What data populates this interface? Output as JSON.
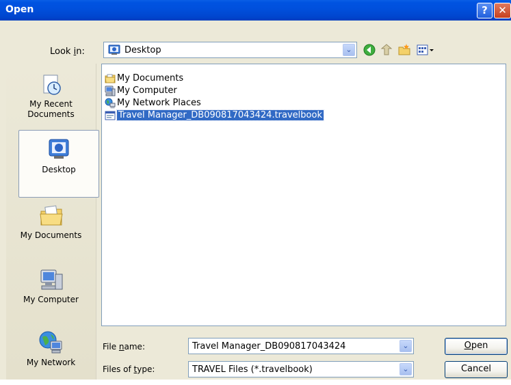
{
  "window": {
    "title": "Open",
    "help_glyph": "?",
    "close_glyph": "✕"
  },
  "lookin": {
    "label_pre": "Look ",
    "label_u": "i",
    "label_post": "n:",
    "value": "Desktop",
    "arrow": "⌄"
  },
  "places": [
    {
      "id": "recent",
      "label1": "My Recent",
      "label2": "Documents",
      "icon": "recent-documents-icon"
    },
    {
      "id": "desktop",
      "label1": "Desktop",
      "label2": "",
      "icon": "desktop-icon"
    },
    {
      "id": "mydocs",
      "label1": "My Documents",
      "label2": "",
      "icon": "my-documents-folder-icon"
    },
    {
      "id": "mycomp",
      "label1": "My Computer",
      "label2": "",
      "icon": "my-computer-icon"
    },
    {
      "id": "mynet",
      "label1": "My Network",
      "label2": "",
      "icon": "my-network-icon"
    }
  ],
  "files": [
    {
      "name": "My Documents",
      "icon": "folder-icon"
    },
    {
      "name": "My Computer",
      "icon": "computer-icon"
    },
    {
      "name": "My Network Places",
      "icon": "network-places-icon"
    },
    {
      "name": "Travel Manager_DB090817043424.travelbook",
      "icon": "travelbook-file-icon",
      "selected": true
    }
  ],
  "filename": {
    "label_pre": "File ",
    "label_u": "n",
    "label_post": "ame:",
    "value": "Travel Manager_DB090817043424"
  },
  "filetype": {
    "label_pre": "Files of ",
    "label_u": "t",
    "label_post": "ype:",
    "value": "TRAVEL Files (*.travelbook)"
  },
  "buttons": {
    "open_u": "O",
    "open_rest": "pen",
    "cancel": "Cancel"
  },
  "colors": {
    "titlebar": "#0050dd",
    "selection": "#316ac5",
    "dialog": "#ece9d8"
  }
}
